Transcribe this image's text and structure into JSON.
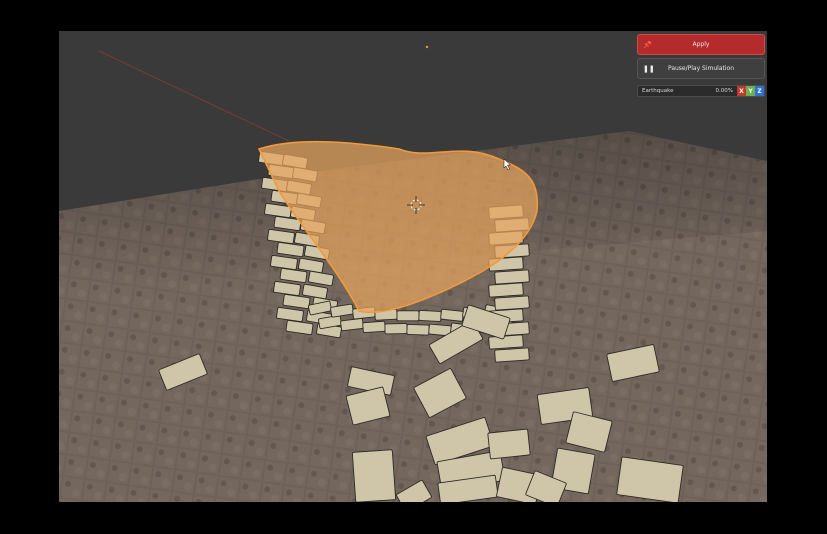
{
  "panel": {
    "apply_label": "Apply",
    "apply_icon": "pin-icon",
    "pause_label": "Pause/Play Simulation",
    "pause_icon": "pause-icon",
    "earthquake_label": "Earthquake",
    "earthquake_value": "0.00%",
    "axes": [
      {
        "label": "X",
        "color": "#c0392b"
      },
      {
        "label": "Y",
        "color": "#6ab04c"
      },
      {
        "label": "Z",
        "color": "#2e6fd8"
      }
    ]
  },
  "colors": {
    "apply_red": "#b52a2a",
    "selection_orange": "#e8a25a",
    "floor": "#6b5f57",
    "sky": "#3a3a3a"
  }
}
